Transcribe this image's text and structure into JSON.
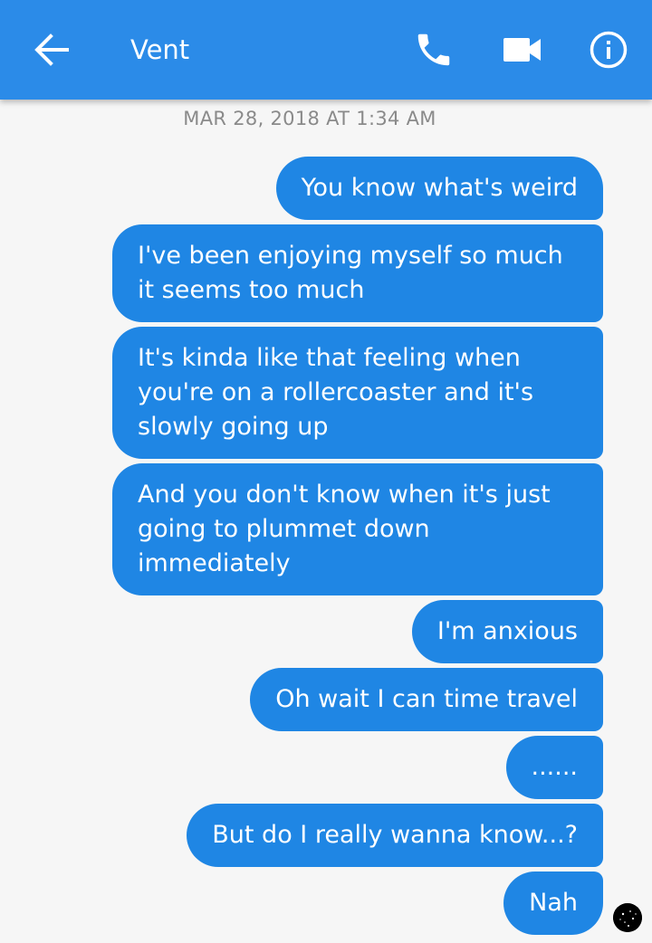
{
  "header": {
    "title": "Vent",
    "back_icon": "arrow-left-icon",
    "call_icon": "phone-icon",
    "video_icon": "video-camera-icon",
    "info_icon": "info-icon",
    "bar_color": "#2b8be8"
  },
  "conversation": {
    "timestamp": "MAR 28, 2018 AT 1:34 AM",
    "bubble_color": "#1f86e4",
    "messages": [
      {
        "text": "You know what's weird"
      },
      {
        "text": "I've been enjoying myself so much it seems too much"
      },
      {
        "text": "It's kinda like that feeling when you're on a rollercoaster and it's slowly going up"
      },
      {
        "text": "And you don't know when it's just going to plummet down immediately"
      },
      {
        "text": "I'm anxious"
      },
      {
        "text": "Oh wait I can time travel"
      },
      {
        "text": "......"
      },
      {
        "text": "But do I really wanna know...?"
      },
      {
        "text": "Nah"
      }
    ]
  }
}
